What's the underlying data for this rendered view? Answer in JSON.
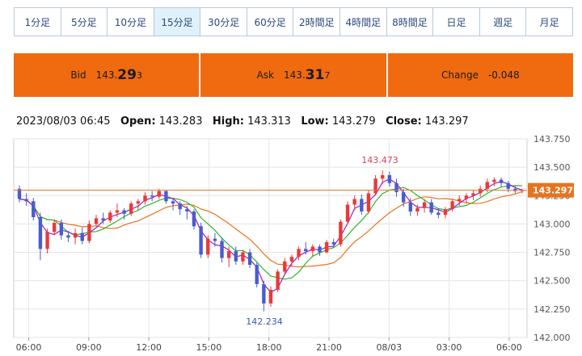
{
  "timeframes": [
    {
      "label": "1分足"
    },
    {
      "label": "5分足"
    },
    {
      "label": "10分足"
    },
    {
      "label": "15分足",
      "active": true
    },
    {
      "label": "30分足"
    },
    {
      "label": "60分足"
    },
    {
      "label": "2時間足"
    },
    {
      "label": "4時間足"
    },
    {
      "label": "8時間足"
    },
    {
      "label": "日足"
    },
    {
      "label": "週足"
    },
    {
      "label": "月足"
    }
  ],
  "quotes": {
    "bid_label": "Bid",
    "bid_main": "143.",
    "bid_big": "29",
    "bid_small": "3",
    "ask_label": "Ask",
    "ask_main": "143.",
    "ask_big": "31",
    "ask_small": "7",
    "change_label": "Change",
    "change_value": "-0.048"
  },
  "ohlc": {
    "datetime": "2023/08/03 06:45",
    "open_label": "Open:",
    "open": "143.283",
    "high_label": "High:",
    "high": "143.313",
    "low_label": "Low:",
    "low": "143.279",
    "close_label": "Close:",
    "close": "143.297"
  },
  "colors": {
    "up": "#e83a3a",
    "down": "#4a5bd0",
    "ma_fast": "#9b1fc4",
    "ma_mid": "#2fb52f",
    "ma_slow": "#e8731f",
    "price_line": "#e8731f",
    "accent": "#f06a0f"
  },
  "chart_data": {
    "type": "candlestick",
    "timeframe": "15分足",
    "x_ticks": [
      "06:00",
      "09:00",
      "12:00",
      "15:00",
      "18:00",
      "21:00",
      "08/03",
      "03:00",
      "06:00"
    ],
    "y_ticks": [
      "143.750",
      "143.500",
      "143.250",
      "143.000",
      "142.750",
      "142.500",
      "142.250",
      "142.000"
    ],
    "ylim": [
      142.0,
      143.75
    ],
    "y_tick_step": 0.25,
    "grid": true,
    "current_price": "143.297",
    "high_annotation": {
      "label": "143.473",
      "value": 143.473
    },
    "low_annotation": {
      "label": "142.234",
      "value": 142.234
    },
    "ohlc_values": [
      [
        143.31,
        143.34,
        143.19,
        143.22
      ],
      [
        143.22,
        143.27,
        143.16,
        143.2
      ],
      [
        143.2,
        143.23,
        143.03,
        143.06
      ],
      [
        143.06,
        143.1,
        142.68,
        142.78
      ],
      [
        142.78,
        142.96,
        142.74,
        142.93
      ],
      [
        142.93,
        143.04,
        142.9,
        143.01
      ],
      [
        143.01,
        143.04,
        142.86,
        142.9
      ],
      [
        142.9,
        142.94,
        142.84,
        142.88
      ],
      [
        142.88,
        142.96,
        142.82,
        142.92
      ],
      [
        142.92,
        142.97,
        142.82,
        142.85
      ],
      [
        142.85,
        143.03,
        142.83,
        143.0
      ],
      [
        143.0,
        143.08,
        142.98,
        143.05
      ],
      [
        143.05,
        143.1,
        143.0,
        143.03
      ],
      [
        143.03,
        143.12,
        143.01,
        143.1
      ],
      [
        143.1,
        143.18,
        143.06,
        143.12
      ],
      [
        143.12,
        143.14,
        143.04,
        143.09
      ],
      [
        143.09,
        143.2,
        143.07,
        143.18
      ],
      [
        143.18,
        143.22,
        143.12,
        143.2
      ],
      [
        143.2,
        143.28,
        143.17,
        143.25
      ],
      [
        143.25,
        143.29,
        143.2,
        143.24
      ],
      [
        143.24,
        143.31,
        143.22,
        143.29
      ],
      [
        143.29,
        143.3,
        143.18,
        143.2
      ],
      [
        143.2,
        143.23,
        143.12,
        143.18
      ],
      [
        143.18,
        143.2,
        143.08,
        143.13
      ],
      [
        143.13,
        143.16,
        143.04,
        143.11
      ],
      [
        143.11,
        143.13,
        142.95,
        142.98
      ],
      [
        142.98,
        143.01,
        142.7,
        142.73
      ],
      [
        142.73,
        142.9,
        142.7,
        142.87
      ],
      [
        142.87,
        142.92,
        142.8,
        142.85
      ],
      [
        142.85,
        142.88,
        142.66,
        142.7
      ],
      [
        142.7,
        142.8,
        142.62,
        142.76
      ],
      [
        142.76,
        142.8,
        142.64,
        142.67
      ],
      [
        142.67,
        142.77,
        142.64,
        142.75
      ],
      [
        142.75,
        142.78,
        142.61,
        142.64
      ],
      [
        142.64,
        142.66,
        142.44,
        142.47
      ],
      [
        142.47,
        142.5,
        142.23,
        142.3
      ],
      [
        142.3,
        142.45,
        142.27,
        142.42
      ],
      [
        142.42,
        142.6,
        142.4,
        142.58
      ],
      [
        142.58,
        142.7,
        142.55,
        142.67
      ],
      [
        142.67,
        142.73,
        142.63,
        142.71
      ],
      [
        142.71,
        142.8,
        142.68,
        142.78
      ],
      [
        142.78,
        142.84,
        142.73,
        142.76
      ],
      [
        142.76,
        142.82,
        142.71,
        142.8
      ],
      [
        142.8,
        142.82,
        142.72,
        142.75
      ],
      [
        142.75,
        142.86,
        142.74,
        142.84
      ],
      [
        142.84,
        142.87,
        142.79,
        142.82
      ],
      [
        142.82,
        143.04,
        142.8,
        143.02
      ],
      [
        143.02,
        143.2,
        143.0,
        143.17
      ],
      [
        143.17,
        143.25,
        143.12,
        143.22
      ],
      [
        143.22,
        143.26,
        143.08,
        143.11
      ],
      [
        143.11,
        143.3,
        143.09,
        143.27
      ],
      [
        143.27,
        143.43,
        143.25,
        143.4
      ],
      [
        143.4,
        143.47,
        143.35,
        143.43
      ],
      [
        143.43,
        143.46,
        143.33,
        143.36
      ],
      [
        143.36,
        143.4,
        143.24,
        143.28
      ],
      [
        143.28,
        143.31,
        143.15,
        143.19
      ],
      [
        143.19,
        143.23,
        143.07,
        143.11
      ],
      [
        143.11,
        143.17,
        143.07,
        143.14
      ],
      [
        143.14,
        143.22,
        143.1,
        143.19
      ],
      [
        143.19,
        143.22,
        143.08,
        143.1
      ],
      [
        143.1,
        143.14,
        143.05,
        143.08
      ],
      [
        143.08,
        143.15,
        143.05,
        143.13
      ],
      [
        143.13,
        143.22,
        143.11,
        143.2
      ],
      [
        143.2,
        143.25,
        143.16,
        143.22
      ],
      [
        143.22,
        143.27,
        143.18,
        143.25
      ],
      [
        143.25,
        143.3,
        143.21,
        143.27
      ],
      [
        143.27,
        143.34,
        143.24,
        143.31
      ],
      [
        143.31,
        143.4,
        143.28,
        143.37
      ],
      [
        143.37,
        143.41,
        143.33,
        143.39
      ],
      [
        143.39,
        143.41,
        143.33,
        143.36
      ],
      [
        143.36,
        143.38,
        143.28,
        143.31
      ],
      [
        143.31,
        143.33,
        143.27,
        143.29
      ],
      [
        143.29,
        143.31,
        143.27,
        143.3
      ]
    ]
  }
}
